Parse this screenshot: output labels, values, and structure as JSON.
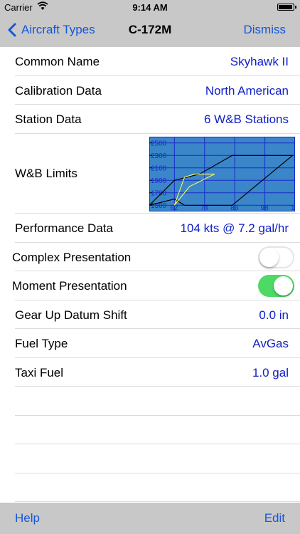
{
  "status_bar": {
    "carrier": "Carrier",
    "time": "9:14 AM",
    "battery_level": 0.95
  },
  "nav": {
    "back_label": "Aircraft Types",
    "title": "C-172M",
    "right_label": "Dismiss"
  },
  "rows": {
    "common_name": {
      "label": "Common Name",
      "value": "Skyhawk II"
    },
    "calibration": {
      "label": "Calibration Data",
      "value": "North American"
    },
    "station": {
      "label": "Station Data",
      "value": "6 W&B Stations"
    },
    "wb_limits": {
      "label": "W&B Limits"
    },
    "performance": {
      "label": "Performance Data",
      "value": "104 kts @ 7.2 gal/hr"
    },
    "complex": {
      "label": "Complex Presentation",
      "on": false
    },
    "moment": {
      "label": "Moment Presentation",
      "on": true
    },
    "gear_up": {
      "label": "Gear Up Datum Shift",
      "value": "0.0 in"
    },
    "fuel_type": {
      "label": "Fuel Type",
      "value": "AvGas"
    },
    "taxi_fuel": {
      "label": "Taxi Fuel",
      "value": "1.0 gal"
    }
  },
  "toolbar": {
    "left_label": "Help",
    "right_label": "Edit"
  },
  "colors": {
    "tint": "#1457d9",
    "value": "#1020c8",
    "switch_on": "#4cd964",
    "chart_bg": "#3a86c8",
    "chart_grid": "#1a2cc8",
    "envelope_normal": "#000000",
    "envelope_utility": "#e8f060"
  },
  "chart_data": {
    "type": "line",
    "x_ticks": [
      "62",
      "74",
      "86",
      "98",
      "11"
    ],
    "y_ticks": [
      "2500",
      "2300",
      "2100",
      "1900",
      "1700",
      "1500"
    ],
    "xlim": [
      52,
      110
    ],
    "ylim": [
      1400,
      2600
    ],
    "series": [
      {
        "color": "#000000",
        "x": [
          52,
          62,
          72,
          85,
          109,
          85,
          66,
          62,
          52
        ],
        "y": [
          1500,
          1900,
          2000,
          2300,
          2300,
          1500,
          1500,
          1600,
          1500
        ]
      },
      {
        "color": "#e8f060",
        "x": [
          62,
          66,
          70,
          78,
          68,
          62
        ],
        "y": [
          1500,
          1950,
          2000,
          2000,
          1800,
          1500
        ]
      }
    ]
  }
}
